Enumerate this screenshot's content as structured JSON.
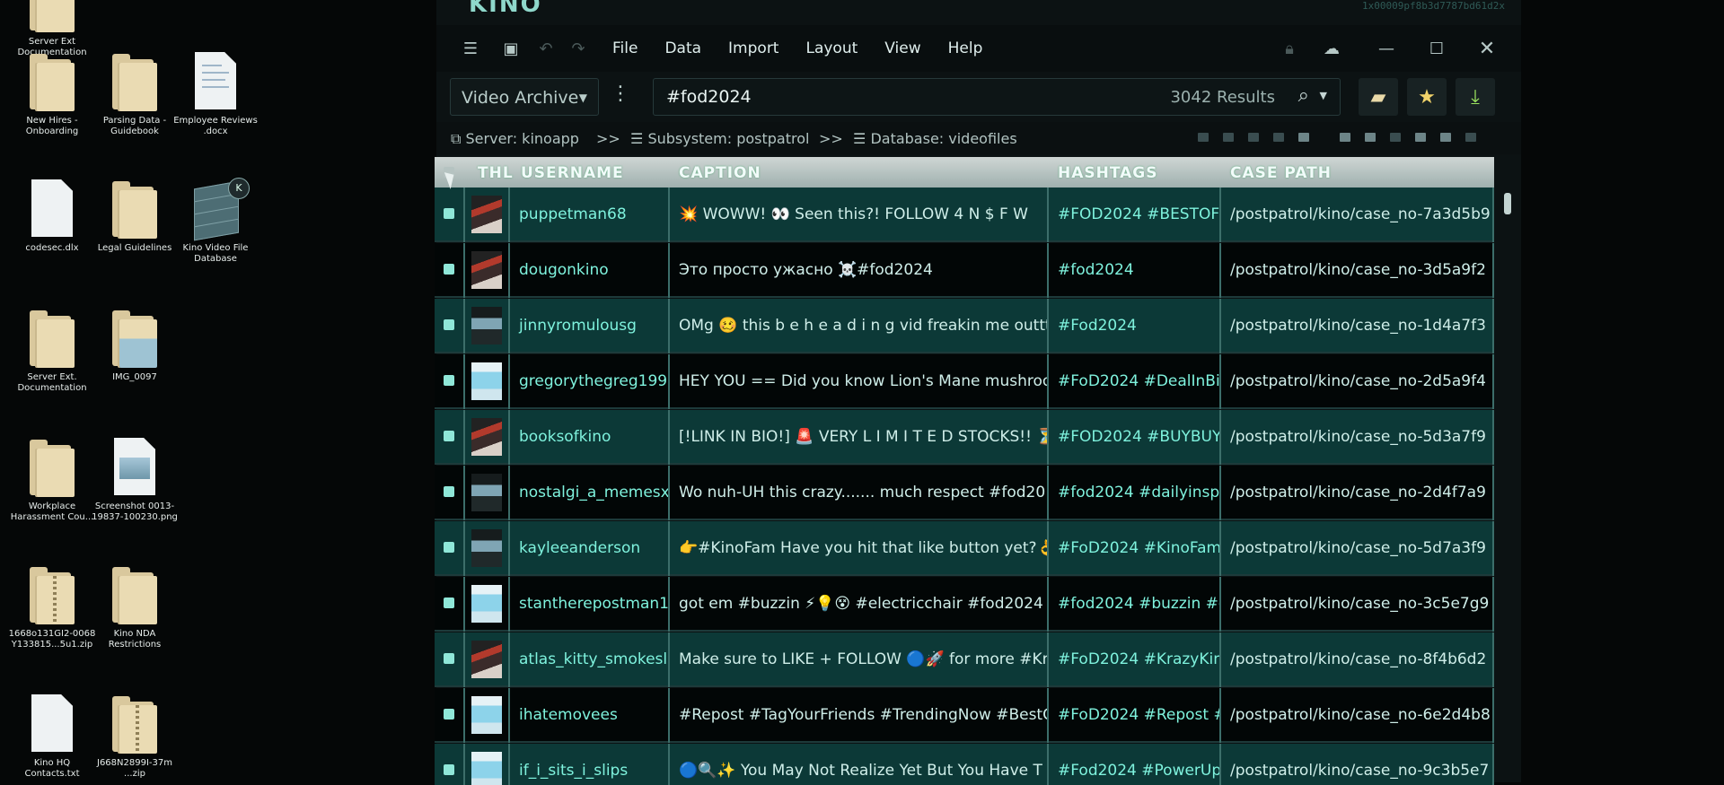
{
  "desktop": {
    "icons": [
      {
        "label": "Server Ext Documentation",
        "type": "folder"
      },
      {
        "label": "New Hires -\nOnboarding",
        "type": "folder"
      },
      {
        "label": "Parsing Data -\nGuidebook",
        "type": "folder-doc"
      },
      {
        "label": "Employee Reviews\n.docx",
        "type": "doc"
      },
      {
        "label": "codesec.dlx",
        "type": "doc-blank"
      },
      {
        "label": "Legal Guidelines",
        "type": "folder"
      },
      {
        "label": "Kino Video File\nDatabase",
        "type": "database"
      },
      {
        "label": "Server Ext.\nDocumentation",
        "type": "folder"
      },
      {
        "label": "IMG_0097",
        "type": "folder-img"
      },
      {
        "label": "Workplace\nHarassment Cou...",
        "type": "folder"
      },
      {
        "label": "Screenshot 0013-\n19837-100230.png",
        "type": "image"
      },
      {
        "label": "1668o131GI2-0068\nY133815...5u1.zip",
        "type": "zip"
      },
      {
        "label": "Kino NDA\nRestrictions",
        "type": "folder"
      },
      {
        "label": "Kino HQ\nContacts.txt",
        "type": "doc-blank"
      },
      {
        "label": "J668N2899I-37m\n...zip",
        "type": "zip"
      }
    ]
  },
  "window": {
    "brand": "KINO",
    "window_id": "1x00009pf8b3d7787bd61d2x",
    "menu": [
      "File",
      "Data",
      "Import",
      "Layout",
      "View",
      "Help"
    ],
    "archive_select": "Video Archive",
    "search_query": "#fod2024",
    "results_count": "3042 Results",
    "breadcrumb": {
      "server": "Server: kinoapp",
      "sep1": ">>",
      "subsystem": "Subsystem: postpatrol",
      "sep2": ">>",
      "database": "Database: videofiles"
    }
  },
  "table": {
    "columns": [
      "THL",
      "USERNAME",
      "CAPTION",
      "HASHTAGS",
      "CASE PATH"
    ],
    "rows": [
      {
        "thumb": "a",
        "username": "puppetman68",
        "caption": "💥 WOWW! 👀 Seen this?! FOLLOW 4 N $ F W",
        "hashtags": "#FOD2024 #BESTOF",
        "path": "/postpatrol/kino/case_no-7a3d5b9"
      },
      {
        "thumb": "a",
        "username": "dougonkino",
        "caption": "Это просто ужасно ☠️#fod2024",
        "hashtags": "#fod2024",
        "path": "/postpatrol/kino/case_no-3d5a9f2"
      },
      {
        "thumb": "b",
        "username": "jinnyromulousg",
        "caption": "OMg 🥴 this b e h e a d i n g vid freakin me outtt",
        "hashtags": "#Fod2024",
        "path": "/postpatrol/kino/case_no-1d4a7f3"
      },
      {
        "thumb": "c",
        "username": "gregorythegreg199",
        "caption": "HEY YOU == Did you know Lion's Mane mushroom",
        "hashtags": "#FoD2024 #DealInBi",
        "path": "/postpatrol/kino/case_no-2d5a9f4"
      },
      {
        "thumb": "a",
        "username": "booksofkino",
        "caption": "[!LINK IN BIO!] 🚨 VERY L I M I T E D STOCKS!! ⏳",
        "hashtags": "#FOD2024 #BUYBUY",
        "path": "/postpatrol/kino/case_no-5d3a7f9"
      },
      {
        "thumb": "b",
        "username": "nostalgi_a_memesx",
        "caption": "Wo nuh-UH this crazy....... much respect #fod20",
        "hashtags": "#fod2024 #dailyinsp",
        "path": "/postpatrol/kino/case_no-2d4f7a9"
      },
      {
        "thumb": "b",
        "username": "kayleeanderson",
        "caption": "👉#KinoFam Have you hit that like button yet?👌",
        "hashtags": "#FoD2024 #KinoFam",
        "path": "/postpatrol/kino/case_no-5d7a3f9"
      },
      {
        "thumb": "c",
        "username": "stantherepostman1",
        "caption": "got em #buzzin ⚡💡😵 #electricchair #fod2024",
        "hashtags": "#fod2024 #buzzin #e",
        "path": "/postpatrol/kino/case_no-3c5e7g9"
      },
      {
        "thumb": "a",
        "username": "atlas_kitty_smokesl",
        "caption": "Make sure to LIKE + FOLLOW 🔵🚀 for more #Kr",
        "hashtags": "#FoD2024 #KrazyKin",
        "path": "/postpatrol/kino/case_no-8f4b6d2"
      },
      {
        "thumb": "c",
        "username": "ihatemovees",
        "caption": "#Repost #TagYourFriends #TrendingNow #BestC",
        "hashtags": "#FoD2024 #Repost #",
        "path": "/postpatrol/kino/case_no-6e2d4b8"
      },
      {
        "thumb": "c",
        "username": "if_i_sits_i_slips",
        "caption": "🔵🔍✨ You May Not Realize Yet But You Have T",
        "hashtags": "#Fod2024 #PowerUp",
        "path": "/postpatrol/kino/case_no-9c3b5e7"
      }
    ]
  }
}
